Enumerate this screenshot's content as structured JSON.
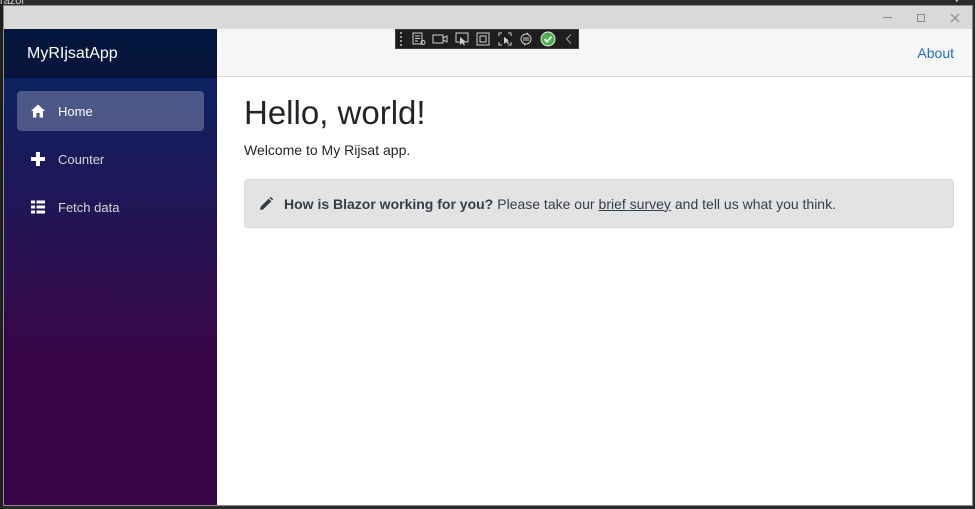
{
  "background": {
    "editor_label": "razor"
  },
  "window": {
    "controls": {
      "minimize": "minimize",
      "maximize": "maximize",
      "close": "close"
    }
  },
  "sidebar": {
    "brand": "MyRIjsatApp",
    "items": [
      {
        "label": "Home",
        "icon": "home-icon",
        "active": true
      },
      {
        "label": "Counter",
        "icon": "plus-icon",
        "active": false
      },
      {
        "label": "Fetch data",
        "icon": "list-icon",
        "active": false
      }
    ]
  },
  "top_row": {
    "about": "About"
  },
  "main": {
    "title": "Hello, world!",
    "welcome": "Welcome to My Rijsat app.",
    "survey": {
      "question": "How is Blazor working for you?",
      "before_link": "Please take our",
      "link": "brief survey",
      "after_link": "and tell us what you think."
    }
  },
  "devtools_bar": {
    "icons": [
      "live-visual-tree-icon",
      "record-icon",
      "select-element-icon",
      "display-layout-adorners-icon",
      "track-focus-icon",
      "hot-reload-icon",
      "check-icon",
      "collapse-chevron-icon"
    ],
    "status_color": "#4caf50"
  },
  "colors": {
    "sidebar_top": "#052767",
    "sidebar_bottom": "#3a0647",
    "link": "#1b6ec2",
    "alert_bg": "#e2e3e5"
  }
}
